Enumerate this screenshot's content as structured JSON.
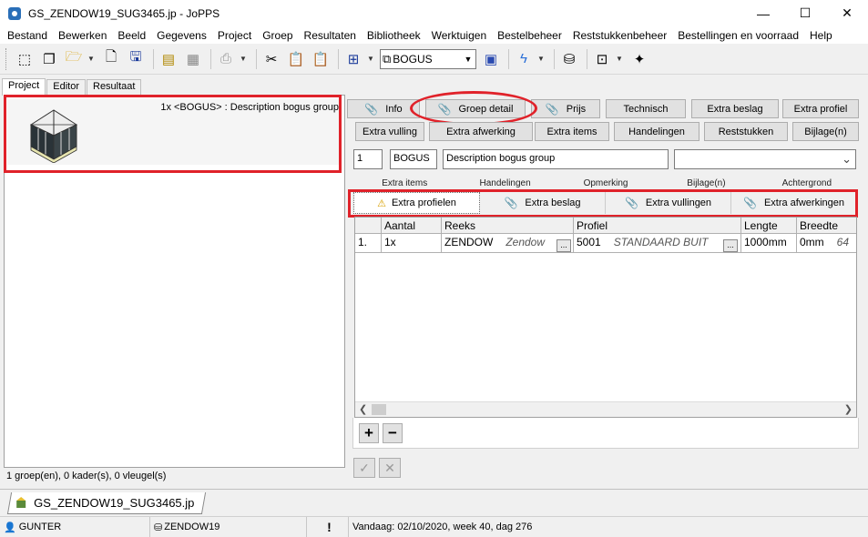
{
  "window": {
    "title": "GS_ZENDOW19_SUG3465.jp - JoPPS",
    "controls": {
      "minimize": "—",
      "maximize": "☐",
      "close": "✕"
    }
  },
  "menu": [
    "Bestand",
    "Bewerken",
    "Beeld",
    "Gegevens",
    "Project",
    "Groep",
    "Resultaten",
    "Bibliotheek",
    "Werktuigen",
    "Bestelbeheer",
    "Reststukkenbeheer",
    "Bestellingen en voorraad",
    "Help"
  ],
  "toolbar": {
    "combo_value": "BOGUS",
    "icons": [
      "select-icon",
      "copy-icon",
      "open-folder-icon",
      "print-preview-icon",
      "save-icon",
      "printer-icon",
      "grid-icon",
      "print-icon",
      "cut-icon",
      "paste-icon",
      "paste-special-icon",
      "frame-icon",
      "window-icon",
      "lightning-icon",
      "database-icon",
      "report-icon",
      "magic-wand-icon"
    ]
  },
  "left_tabs": [
    "Project",
    "Editor",
    "Resultaat"
  ],
  "project": {
    "item_label": "1x <BOGUS> : Description bogus group",
    "status": "1 groep(en), 0 kader(s), 0 vleugel(s)"
  },
  "buttons_row1": [
    "Info",
    "Groep detail",
    "Prijs",
    "Technisch",
    "Extra beslag",
    "Extra profiel"
  ],
  "buttons_row2": [
    "Extra vulling",
    "Extra afwerking",
    "Extra items",
    "Handelingen",
    "Reststukken",
    "Bijlage(n)"
  ],
  "fields": {
    "quantity": "1",
    "code": "BOGUS",
    "description": "Description bogus group",
    "select_arrow": "⌄"
  },
  "sub_tabs_top": [
    "Extra items",
    "Handelingen",
    "Opmerking",
    "Bijlage(n)",
    "Achtergrond"
  ],
  "sub_tabs": [
    "Extra profielen",
    "Extra beslag",
    "Extra vullingen",
    "Extra afwerkingen"
  ],
  "grid": {
    "headers": [
      "Aantal",
      "Reeks",
      "Profiel",
      "Lengte",
      "Breedte"
    ],
    "rows": [
      {
        "index": "1.",
        "aantal": "1x",
        "reeks": "ZENDOW",
        "reeks_desc": "Zendow",
        "profiel": "5001",
        "profiel_desc": "STANDAARD BUIT",
        "lengte": "1000mm",
        "breedte": "0mm",
        "breedte_extra": "64"
      }
    ]
  },
  "actions": {
    "add": "+",
    "remove": "−",
    "confirm": "✓",
    "cancel": "✕"
  },
  "file_tab": "GS_ZENDOW19_SUG3465.jp",
  "statusbar": {
    "user": "GUNTER",
    "database": "ZENDOW19",
    "alert": "!",
    "date": "Vandaag: 02/10/2020, week 40, dag 276"
  },
  "colors": {
    "annotation_red": "#e0222a",
    "button_face": "#e1e1e1"
  }
}
